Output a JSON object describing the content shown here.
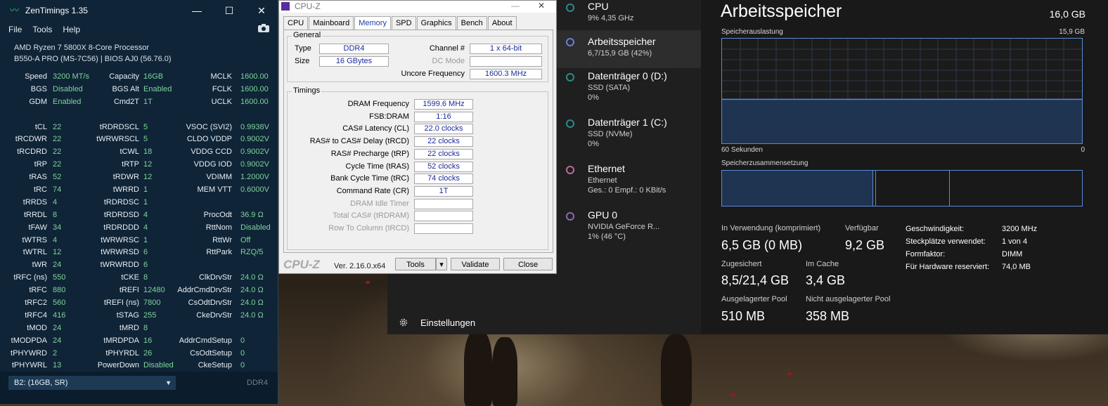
{
  "zentimings": {
    "title": "ZenTimings 1.35",
    "menu": [
      "File",
      "Tools",
      "Help"
    ],
    "cpu": "AMD Ryzen 7 5800X 8-Core Processor",
    "board": "B550-A PRO (MS-7C56) | BIOS AJ0 (56.76.0)",
    "rows": [
      [
        "Speed",
        "3200 MT/s",
        "Capacity",
        "16GB",
        "MCLK",
        "1600.00"
      ],
      [
        "BGS",
        "Disabled",
        "BGS Alt",
        "Enabled",
        "FCLK",
        "1600.00"
      ],
      [
        "GDM",
        "Enabled",
        "Cmd2T",
        "1T",
        "UCLK",
        "1600.00"
      ],
      [
        "",
        "",
        "",
        "",
        "",
        ""
      ],
      [
        "tCL",
        "22",
        "tRDRDSCL",
        "5",
        "VSOC (SVI2)",
        "0.9938V"
      ],
      [
        "tRCDWR",
        "22",
        "tWRWRSCL",
        "5",
        "CLDO VDDP",
        "0.9002V"
      ],
      [
        "tRCDRD",
        "22",
        "tCWL",
        "18",
        "VDDG CCD",
        "0.9002V"
      ],
      [
        "tRP",
        "22",
        "tRTP",
        "12",
        "VDDG IOD",
        "0.9002V"
      ],
      [
        "tRAS",
        "52",
        "tRDWR",
        "12",
        "VDIMM",
        "1.2000V"
      ],
      [
        "tRC",
        "74",
        "tWRRD",
        "1",
        "MEM VTT",
        "0.6000V"
      ],
      [
        "tRRDS",
        "4",
        "tRDRDSC",
        "1",
        "",
        ""
      ],
      [
        "tRRDL",
        "8",
        "tRDRDSD",
        "4",
        "ProcOdt",
        "36.9 Ω"
      ],
      [
        "tFAW",
        "34",
        "tRDRDDD",
        "4",
        "RttNom",
        "Disabled"
      ],
      [
        "tWTRS",
        "4",
        "tWRWRSC",
        "1",
        "RttWr",
        "Off"
      ],
      [
        "tWTRL",
        "12",
        "tWRWRSD",
        "6",
        "RttPark",
        "RZQ/5"
      ],
      [
        "tWR",
        "24",
        "tWRWRDD",
        "6",
        "",
        ""
      ],
      [
        "tRFC (ns)",
        "550",
        "tCKE",
        "8",
        "ClkDrvStr",
        "24.0 Ω"
      ],
      [
        "tRFC",
        "880",
        "tREFI",
        "12480",
        "AddrCmdDrvStr",
        "24.0 Ω"
      ],
      [
        "tRFC2",
        "560",
        "tREFI (ns)",
        "7800",
        "CsOdtDrvStr",
        "24.0 Ω"
      ],
      [
        "tRFC4",
        "416",
        "tSTAG",
        "255",
        "CkeDrvStr",
        "24.0 Ω"
      ],
      [
        "tMOD",
        "24",
        "tMRD",
        "8",
        "",
        ""
      ],
      [
        "tMODPDA",
        "24",
        "tMRDPDA",
        "16",
        "AddrCmdSetup",
        "0"
      ],
      [
        "tPHYWRD",
        "2",
        "tPHYRDL",
        "26",
        "CsOdtSetup",
        "0"
      ],
      [
        "tPHYWRL",
        "13",
        "PowerDown",
        "Disabled",
        "CkeSetup",
        "0"
      ]
    ],
    "module": "B2: (16GB, SR)",
    "memtype": "DDR4"
  },
  "cpuz": {
    "title": "CPU-Z",
    "tabs": [
      "CPU",
      "Mainboard",
      "Memory",
      "SPD",
      "Graphics",
      "Bench",
      "About"
    ],
    "active_tab": "Memory",
    "general_label": "General",
    "type_label": "Type",
    "type": "DDR4",
    "size_label": "Size",
    "size": "16 GBytes",
    "channel_label": "Channel #",
    "channel": "1 x 64-bit",
    "dcmode_label": "DC Mode",
    "dcmode": "",
    "uncore_label": "Uncore Frequency",
    "uncore": "1600.3 MHz",
    "timings_label": "Timings",
    "timings": [
      {
        "label": "DRAM Frequency",
        "value": "1599.6 MHz",
        "dim": false
      },
      {
        "label": "FSB:DRAM",
        "value": "1:16",
        "dim": false
      },
      {
        "label": "CAS# Latency (CL)",
        "value": "22.0 clocks",
        "dim": false
      },
      {
        "label": "RAS# to CAS# Delay (tRCD)",
        "value": "22 clocks",
        "dim": false
      },
      {
        "label": "RAS# Precharge (tRP)",
        "value": "22 clocks",
        "dim": false
      },
      {
        "label": "Cycle Time (tRAS)",
        "value": "52 clocks",
        "dim": false
      },
      {
        "label": "Bank Cycle Time (tRC)",
        "value": "74 clocks",
        "dim": false
      },
      {
        "label": "Command Rate (CR)",
        "value": "1T",
        "dim": false
      },
      {
        "label": "DRAM Idle Timer",
        "value": "",
        "dim": true
      },
      {
        "label": "Total CAS# (tRDRAM)",
        "value": "",
        "dim": true
      },
      {
        "label": "Row To Column (tRCD)",
        "value": "",
        "dim": true
      }
    ],
    "brand": "CPU-Z",
    "version": "Ver. 2.16.0.x64",
    "tools_btn": "Tools",
    "validate_btn": "Validate",
    "close_btn": "Close"
  },
  "taskmgr": {
    "resources": [
      {
        "name": "CPU",
        "s1": "9% 4,35 GHz",
        "s2": "",
        "color": "#2b8a86",
        "selected": false
      },
      {
        "name": "Arbeitsspeicher",
        "s1": "6,7/15,9 GB (42%)",
        "s2": "",
        "color": "#6b7fd1",
        "selected": true
      },
      {
        "name": "Datenträger 0 (D:)",
        "s1": "SSD (SATA)",
        "s2": "0%",
        "color": "#2b8a86",
        "selected": false
      },
      {
        "name": "Datenträger 1 (C:)",
        "s1": "SSD (NVMe)",
        "s2": "0%",
        "color": "#2b8a86",
        "selected": false
      },
      {
        "name": "Ethernet",
        "s1": "Ethernet",
        "s2": "Ges.: 0 Empf.: 0 KBit/s",
        "color": "#c06a9a",
        "selected": false
      },
      {
        "name": "GPU 0",
        "s1": "NVIDIA GeForce R...",
        "s2": "1% (46 °C)",
        "color": "#8a6ab0",
        "selected": false
      }
    ],
    "settings": "Einstellungen",
    "heading": "Arbeitsspeicher",
    "total": "16,0 GB",
    "usage_label": "Speicherauslastung",
    "usage_max": "15,9 GB",
    "usage_fraction": 0.42,
    "time_label": "60 Sekunden",
    "time_zero": "0",
    "comp_label": "Speicherzusammensetzung",
    "stats": {
      "in_use_label": "In Verwendung (komprimiert)",
      "in_use": "6,5 GB (0 MB)",
      "available_label": "Verfügbar",
      "available": "9,2 GB",
      "committed_label": "Zugesichert",
      "committed": "8,5/21,4 GB",
      "cached_label": "Im Cache",
      "cached": "3,4 GB",
      "paged_label": "Ausgelagerter Pool",
      "paged": "510 MB",
      "nonpaged_label": "Nicht ausgelagerter Pool",
      "nonpaged": "358 MB"
    },
    "props": [
      [
        "Geschwindigkeit:",
        "3200 MHz"
      ],
      [
        "Steckplätze verwendet:",
        "1 von 4"
      ],
      [
        "Formfaktor:",
        "DIMM"
      ],
      [
        "Für Hardware reserviert:",
        "74,0 MB"
      ]
    ]
  }
}
